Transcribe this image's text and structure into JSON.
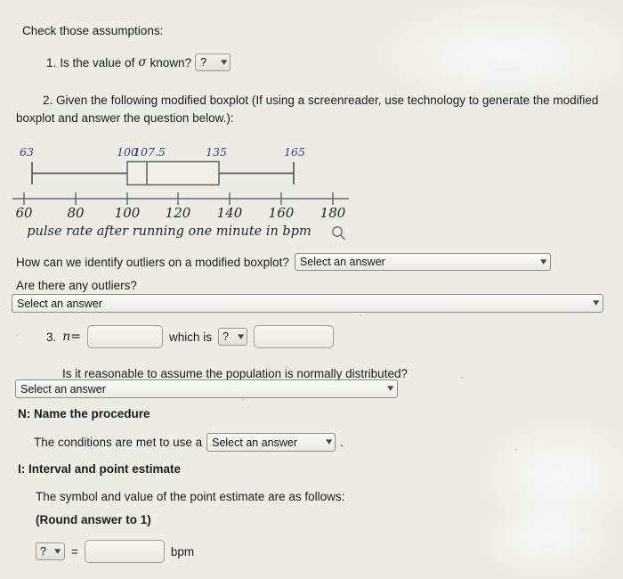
{
  "header": {
    "check_assumptions": "Check those assumptions:"
  },
  "q1": {
    "number": "1.",
    "text_before": "Is the value of",
    "symbol": "σ",
    "text_after": "known?",
    "select_value": "?"
  },
  "q2": {
    "number": "2.",
    "text": "Given the following modified boxplot (If using a screenreader, use technology to generate the modified boxplot and answer the question below.):"
  },
  "boxplot": {
    "xlabel": "pulse rate after running one minute in bpm",
    "zoom_icon": "magnifier-icon",
    "axis_ticks": [
      "60",
      "80",
      "100",
      "120",
      "140",
      "160",
      "180"
    ],
    "value_labels": [
      "63",
      "100",
      "107.5",
      "135",
      "165"
    ],
    "label_color": "#3b3f7a",
    "line_color": "#55555f"
  },
  "chart_data": {
    "type": "boxplot",
    "title": "",
    "xlabel": "pulse rate after running one minute in bpm",
    "ylabel": "",
    "xlim": [
      58,
      184
    ],
    "xticks": [
      60,
      80,
      100,
      120,
      140,
      160,
      180
    ],
    "grid": false,
    "legend": "none",
    "series": [
      {
        "name": "pulse rate after running one minute in bpm",
        "min_whisker": 63,
        "q1": 100,
        "median": 107.5,
        "q3": 135,
        "max_whisker": 165,
        "outliers": [],
        "labels": {
          "min_whisker": "63",
          "q1": "100",
          "median": "107.5",
          "q3": "135",
          "max_whisker": "165"
        }
      }
    ]
  },
  "outliers_question": {
    "label": "How can we identify outliers on a modified boxplot?",
    "select_value": "Select an answer"
  },
  "any_outliers": {
    "label": "Are there any outliers?",
    "select_value": "Select an answer"
  },
  "q3": {
    "number": "3.",
    "var": "n=",
    "input_value": "",
    "middle_text": "which is",
    "select_value": "?",
    "input2_value": ""
  },
  "normal_question": {
    "label": "Is it reasonable to assume the population is normally distributed?",
    "select_value": "Select an answer"
  },
  "name_procedure": {
    "heading": "N: Name the procedure",
    "text_before": "The conditions are met to use a",
    "select_value": "Select an answer",
    "text_after": "."
  },
  "interval": {
    "heading": "I: Interval and point estimate",
    "symbol_text": "The symbol and value of the point estimate are as follows:",
    "round_text": "(Round answer to 1)",
    "select_value": "?",
    "equals": "=",
    "input_value": "",
    "unit": "bpm"
  }
}
